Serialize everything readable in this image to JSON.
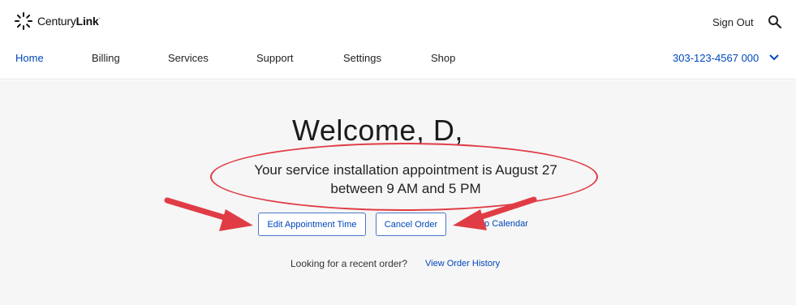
{
  "header": {
    "logo_text": "CenturyLink",
    "logo_part1": "Century",
    "logo_part2": "Link",
    "logo_mark": "·",
    "sign_out_label": "Sign Out",
    "search_icon": "search-icon"
  },
  "nav": {
    "items": [
      {
        "label": "Home",
        "active": true
      },
      {
        "label": "Billing",
        "active": false
      },
      {
        "label": "Services",
        "active": false
      },
      {
        "label": "Support",
        "active": false
      },
      {
        "label": "Settings",
        "active": false
      },
      {
        "label": "Shop",
        "active": false
      }
    ],
    "account_number": "303-123-4567 000"
  },
  "main": {
    "welcome": "Welcome, D,",
    "appointment_line1": "Your service installation appointment is August 27",
    "appointment_line2": "between 9 AM and 5 PM",
    "edit_button_label": "Edit Appointment Time",
    "cancel_button_label": "Cancel Order",
    "calendar_link_label": "to Calendar",
    "looking_text": "Looking for a recent order?",
    "history_link_label": "View Order History"
  },
  "colors": {
    "brand_blue": "#0047bb",
    "annotation_red": "#e03c45",
    "background": "#f6f6f6"
  }
}
